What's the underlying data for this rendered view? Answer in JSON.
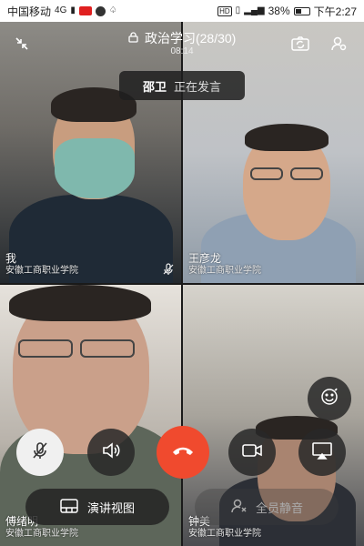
{
  "status_bar": {
    "carrier": "中国移动",
    "network": "4G",
    "battery": "38%",
    "time": "下午2:27",
    "hd": "HD"
  },
  "meeting": {
    "title": "政治学习(28/30)",
    "duration": "08:14"
  },
  "speaking_banner": {
    "name": "邵卫",
    "status": "正在发言"
  },
  "tiles": [
    {
      "name": "我",
      "org": "安徽工商职业学院"
    },
    {
      "name": "王彦龙",
      "org": "安徽工商职业学院"
    },
    {
      "name": "傅绪明",
      "org": "安徽工商职业学院"
    },
    {
      "name": "钟美",
      "org": "安徽工商职业学院"
    }
  ],
  "controls": {
    "speaker_view_label": "演讲视图",
    "mute_all_label": "全员静音"
  },
  "colors": {
    "end_call": "#f04a2e",
    "control_bg": "#282828"
  },
  "icons": [
    "collapse-icon",
    "lock-icon",
    "flip-camera-icon",
    "participants-icon",
    "mic-off-icon",
    "speaker-icon",
    "hangup-icon",
    "video-camera-icon",
    "screen-share-icon",
    "emoji-icon",
    "speaker-view-icon",
    "mute-all-icon"
  ]
}
